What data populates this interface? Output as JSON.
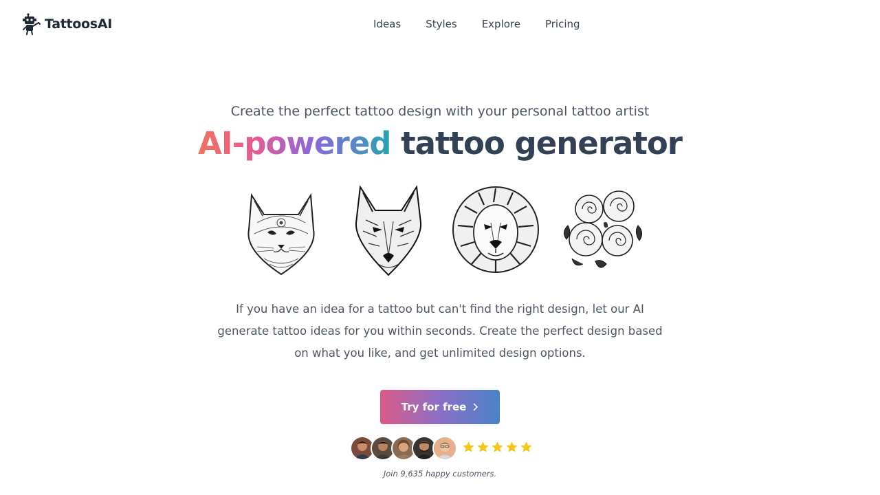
{
  "header": {
    "logo_text": "TattoosAI",
    "logo_icon": "robot-icon",
    "nav": [
      {
        "label": "Ideas"
      },
      {
        "label": "Styles"
      },
      {
        "label": "Explore"
      },
      {
        "label": "Pricing"
      }
    ]
  },
  "hero": {
    "subtitle": "Create the perfect tattoo design with your personal tattoo artist",
    "title_highlight": "AI-powered",
    "title_rest": " tattoo generator",
    "gradient_colors": [
      "#f0735f",
      "#e35b93",
      "#8f66d9",
      "#2aa3b0"
    ],
    "title_color": "#334155",
    "tattoos": [
      {
        "subject": "cat",
        "icon": "cat-tattoo-image"
      },
      {
        "subject": "wolf",
        "icon": "wolf-tattoo-image"
      },
      {
        "subject": "lion",
        "icon": "lion-tattoo-image"
      },
      {
        "subject": "roses",
        "icon": "roses-tattoo-image"
      }
    ],
    "description": "If you have an idea for a tattoo but can't find the right design, let our AI generate tattoo ideas for you within seconds. Create the perfect design based on what you like, and get unlimited design options.",
    "cta_label": "Try for free",
    "cta_icon": "chevron-right-icon",
    "cta_gradient": [
      "#db5a88",
      "#8b6fc6",
      "#4a82c7"
    ]
  },
  "social_proof": {
    "avatar_count": 5,
    "rating": 5,
    "rating_max": 5,
    "star_color": "#f5c518",
    "caption": "Join 9,635 happy customers."
  }
}
